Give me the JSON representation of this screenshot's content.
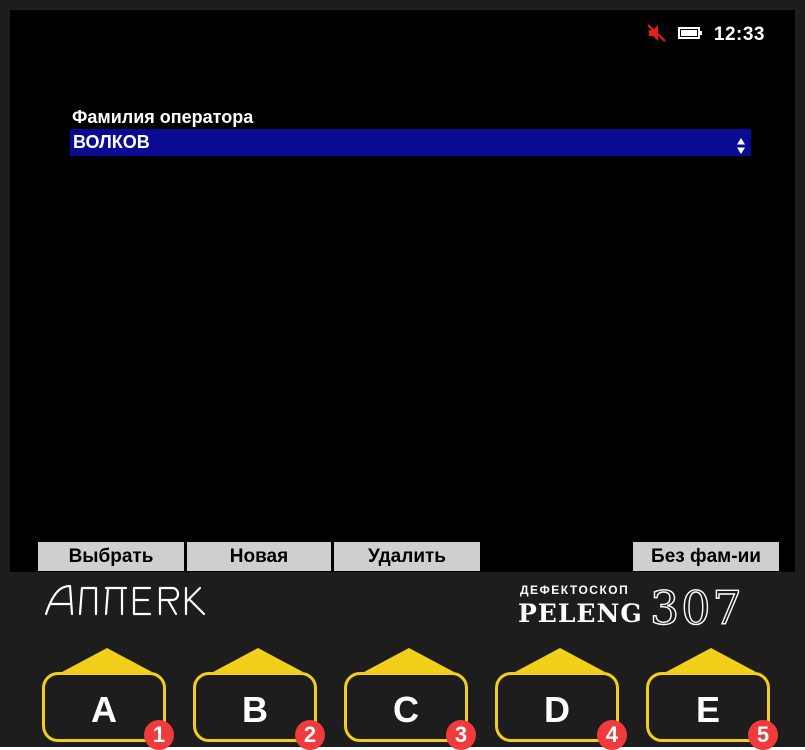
{
  "status": {
    "clock": "12:33",
    "icons": [
      "sound-muted-icon",
      "battery-icon"
    ],
    "mute_icon_color": "#e02020"
  },
  "operator_field": {
    "label": "Фамилия оператора",
    "value": "ВОЛКОВ",
    "highlight_color": "#0a0a94"
  },
  "softkeys": [
    "Выбрать",
    "Новая",
    "Удалить",
    "Без фам-ии"
  ],
  "brand": {
    "logo": "АЛТЕК",
    "subtitle": "ДЕФЕКТОСКОП",
    "name": "PELENG",
    "model": "307"
  },
  "keys": [
    {
      "letter": "A",
      "number": "1"
    },
    {
      "letter": "B",
      "number": "2"
    },
    {
      "letter": "C",
      "number": "3"
    },
    {
      "letter": "D",
      "number": "4"
    },
    {
      "letter": "E",
      "number": "5"
    }
  ],
  "colors": {
    "key_outline": "#f2cf1a",
    "key_number_badge": "#ef3b3b",
    "panel": "#1d1d1d"
  }
}
